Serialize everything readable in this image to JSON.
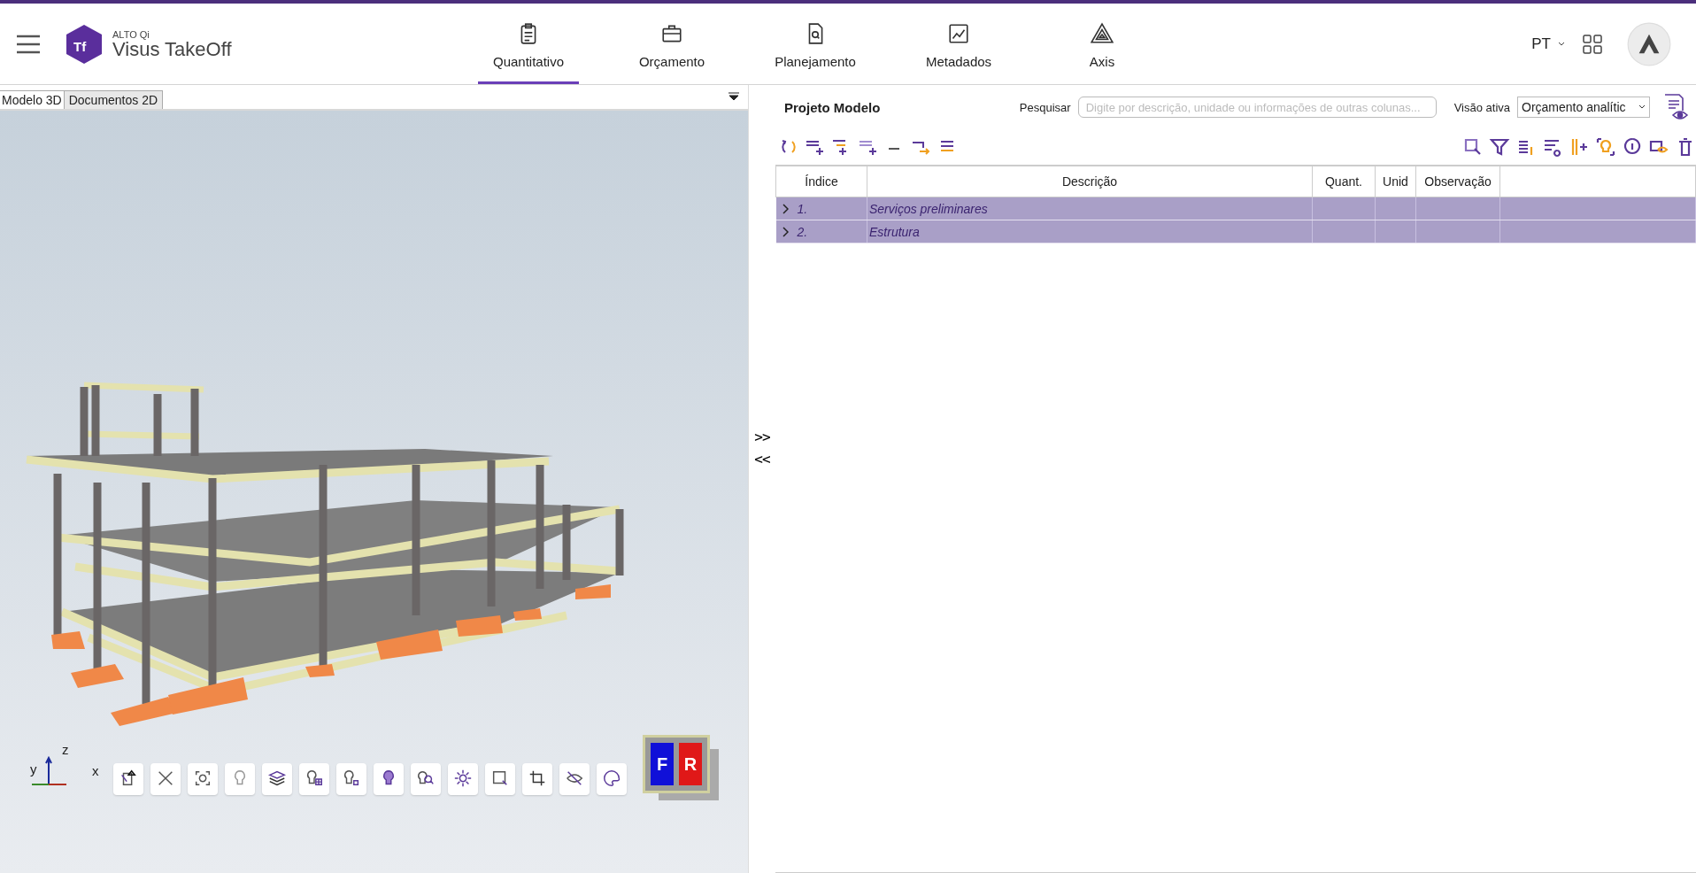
{
  "header": {
    "brand": "ALTO Qi",
    "product": "Visus TakeOff",
    "logo_mark": "Tf",
    "language": "PT",
    "nav": [
      {
        "label": "Quantitativo",
        "selected": true
      },
      {
        "label": "Orçamento",
        "selected": false
      },
      {
        "label": "Planejamento",
        "selected": false
      },
      {
        "label": "Metadados",
        "selected": false
      },
      {
        "label": "Axis",
        "selected": false
      }
    ]
  },
  "left_panel": {
    "tabs": [
      {
        "label": "Modelo 3D",
        "selected": true
      },
      {
        "label": "Documentos 2D",
        "selected": false
      }
    ],
    "axes": {
      "z": "z",
      "y": "y",
      "x": "x"
    },
    "view_cube": {
      "front": "F",
      "right": "R"
    }
  },
  "splitter": {
    "expand": ">>",
    "collapse": "<<"
  },
  "right_panel": {
    "title": "Projeto Modelo",
    "search_label": "Pesquisar",
    "search": {
      "placeholder": "Digite por descrição, unidade ou informações de outras colunas..."
    },
    "view_label": "Visão ativa",
    "view_value": "Orçamento analític",
    "table": {
      "columns": [
        "Índice",
        "Descrição",
        "Quant.",
        "Unid",
        "Observação"
      ],
      "rows": [
        {
          "index": "1.",
          "description": "Serviços preliminares",
          "expanded": false
        },
        {
          "index": "2.",
          "description": "Estrutura",
          "expanded": false
        }
      ]
    }
  }
}
